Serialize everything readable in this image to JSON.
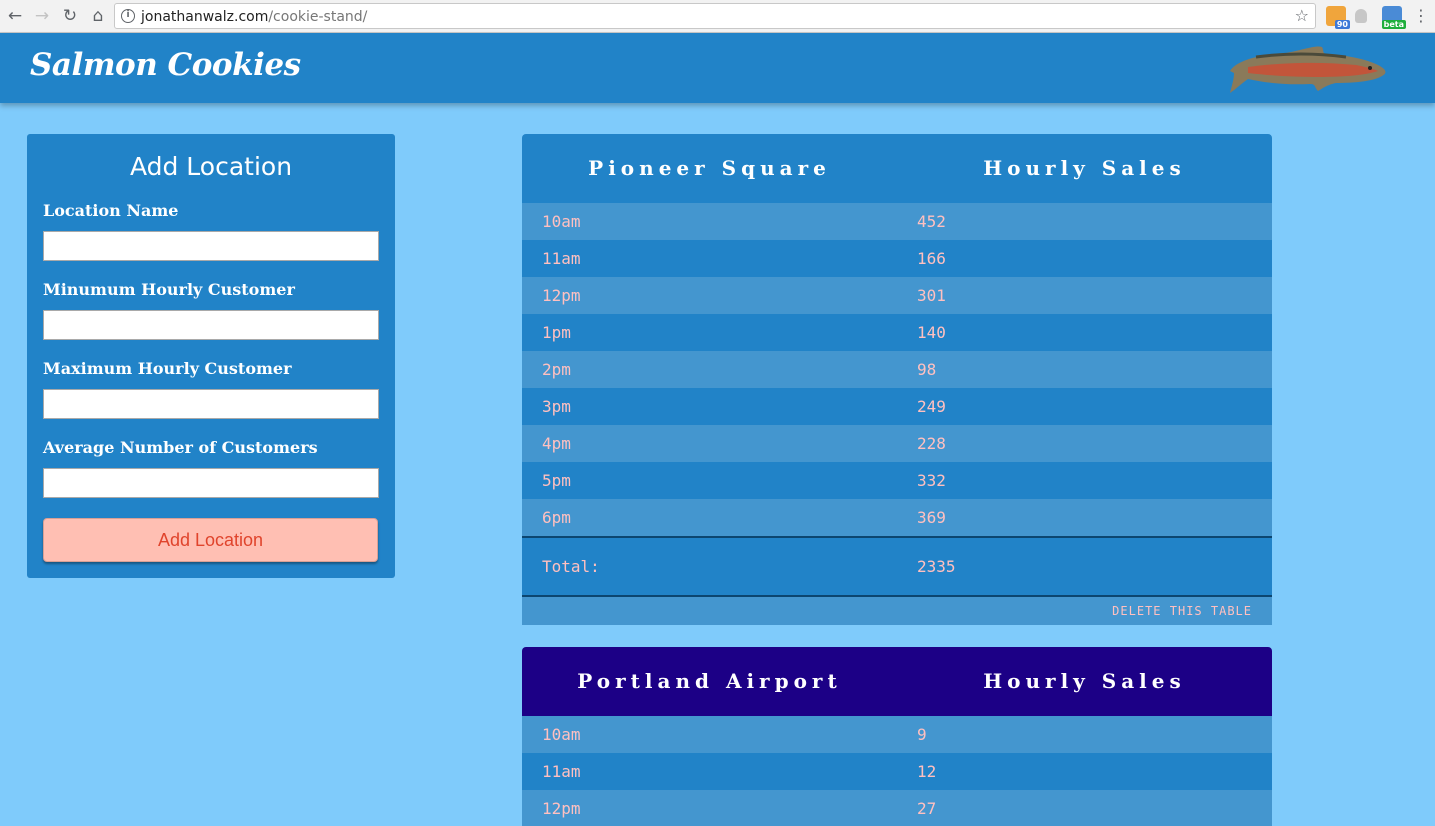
{
  "browser": {
    "url_host": "jonathanwalz.com",
    "url_path": "/cookie-stand/",
    "ext_rss_badge": "90",
    "ext_box_badge": "beta"
  },
  "header": {
    "logo": "Salmon Cookies"
  },
  "form": {
    "title": "Add Location",
    "fields": [
      {
        "label": "Location Name",
        "value": ""
      },
      {
        "label": "Minumum Hourly Customer",
        "value": ""
      },
      {
        "label": "Maximum Hourly Customer",
        "value": ""
      },
      {
        "label": "Average Number of Customers",
        "value": ""
      }
    ],
    "submit_label": "Add Location"
  },
  "stores": [
    {
      "name": "Pioneer Square",
      "sales_header": "Hourly Sales",
      "header_color": "#2183c8",
      "rows": [
        {
          "hour": "10am",
          "sales": "452"
        },
        {
          "hour": "11am",
          "sales": "166"
        },
        {
          "hour": "12pm",
          "sales": "301"
        },
        {
          "hour": "1pm",
          "sales": "140"
        },
        {
          "hour": "2pm",
          "sales": "98"
        },
        {
          "hour": "3pm",
          "sales": "249"
        },
        {
          "hour": "4pm",
          "sales": "228"
        },
        {
          "hour": "5pm",
          "sales": "332"
        },
        {
          "hour": "6pm",
          "sales": "369"
        }
      ],
      "total_label": "Total:",
      "total": "2335",
      "delete_label": "DELETE THIS TABLE"
    },
    {
      "name": "Portland Airport",
      "sales_header": "Hourly Sales",
      "header_color": "#1c0086",
      "rows": [
        {
          "hour": "10am",
          "sales": "9"
        },
        {
          "hour": "11am",
          "sales": "12"
        },
        {
          "hour": "12pm",
          "sales": "27"
        }
      ]
    }
  ]
}
